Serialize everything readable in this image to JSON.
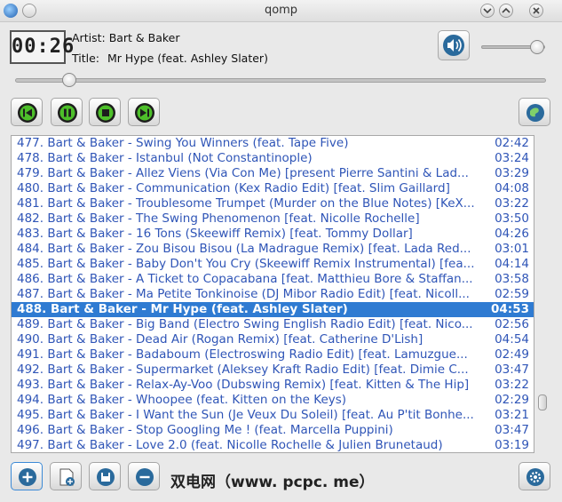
{
  "window": {
    "title": "qomp"
  },
  "player": {
    "time": "00:26",
    "artist_label": "Artist:",
    "artist": "Bart & Baker",
    "title_label": "Title:",
    "title": "Mr Hype (feat. Ashley Slater)",
    "seek_position": 0.09,
    "volume": 0.97
  },
  "playlist": {
    "current_index": 11,
    "items": [
      {
        "text": "477. Bart & Baker - Swing You Winners (feat. Tape Five)",
        "duration": "02:42"
      },
      {
        "text": "478. Bart & Baker - Istanbul (Not Constantinople)",
        "duration": "03:24"
      },
      {
        "text": "479. Bart & Baker - Allez Viens (Via Con Me) [present Pierre Santini & Lad...",
        "duration": "03:29"
      },
      {
        "text": "480. Bart & Baker - Communication (Kex Radio Edit) [feat. Slim Gaillard]",
        "duration": "04:08"
      },
      {
        "text": "481. Bart & Baker - Troublesome Trumpet (Murder on the Blue Notes) [KeX...",
        "duration": "03:22"
      },
      {
        "text": "482. Bart & Baker - The Swing Phenomenon [feat. Nicolle Rochelle]",
        "duration": "03:50"
      },
      {
        "text": "483. Bart & Baker - 16 Tons (Skeewiff Remix) [feat. Tommy Dollar]",
        "duration": "04:26"
      },
      {
        "text": "484. Bart & Baker - Zou Bisou Bisou (La Madrague Remix) [feat. Lada Red...",
        "duration": "03:01"
      },
      {
        "text": "485. Bart & Baker - Baby Don't You Cry (Skeewiff Remix Instrumental) [fea...",
        "duration": "04:14"
      },
      {
        "text": "486. Bart & Baker - A Ticket to Copacabana [feat. Matthieu Bore & Staffan...",
        "duration": "03:58"
      },
      {
        "text": "487. Bart & Baker - Ma Petite Tonkinoise (DJ Mibor Radio Edit) [feat. Nicoll...",
        "duration": "02:59"
      },
      {
        "text": "488. Bart & Baker - Mr Hype (feat. Ashley Slater)",
        "duration": "04:53"
      },
      {
        "text": "489. Bart & Baker - Big Band (Electro Swing English Radio Edit) [feat. Nico...",
        "duration": "02:56"
      },
      {
        "text": "490. Bart & Baker - Dead Air (Rogan Remix) [feat. Catherine D'Lish]",
        "duration": "04:54"
      },
      {
        "text": "491. Bart & Baker - Badaboum (Electroswing Radio Edit) [feat. Lamuzgue...",
        "duration": "02:49"
      },
      {
        "text": "492. Bart & Baker - Supermarket (Aleksey Kraft Radio Edit) [feat. Dimie C...",
        "duration": "03:47"
      },
      {
        "text": "493. Bart & Baker - Relax-Ay-Voo (Dubswing Remix) [feat. Kitten & The Hip]",
        "duration": "03:22"
      },
      {
        "text": "494. Bart & Baker - Whoopee (feat. Kitten on the Keys)",
        "duration": "02:29"
      },
      {
        "text": "495. Bart & Baker - I Want the Sun (Je Veux Du Soleil) [feat. Au P'tit Bonhe...",
        "duration": "03:21"
      },
      {
        "text": "496. Bart & Baker - Stop Googling Me ! (feat. Marcella Puppini)",
        "duration": "03:47"
      },
      {
        "text": "497. Bart & Baker - Love 2.0 (feat. Nicolle Rochelle & Julien Brunetaud)",
        "duration": "03:19"
      }
    ]
  },
  "watermark": "双电网（www. pcpc. me）",
  "colors": {
    "accent": "#2f7bd2",
    "track_text": "#2f55b7",
    "button_icon": "#2a6a9c"
  }
}
